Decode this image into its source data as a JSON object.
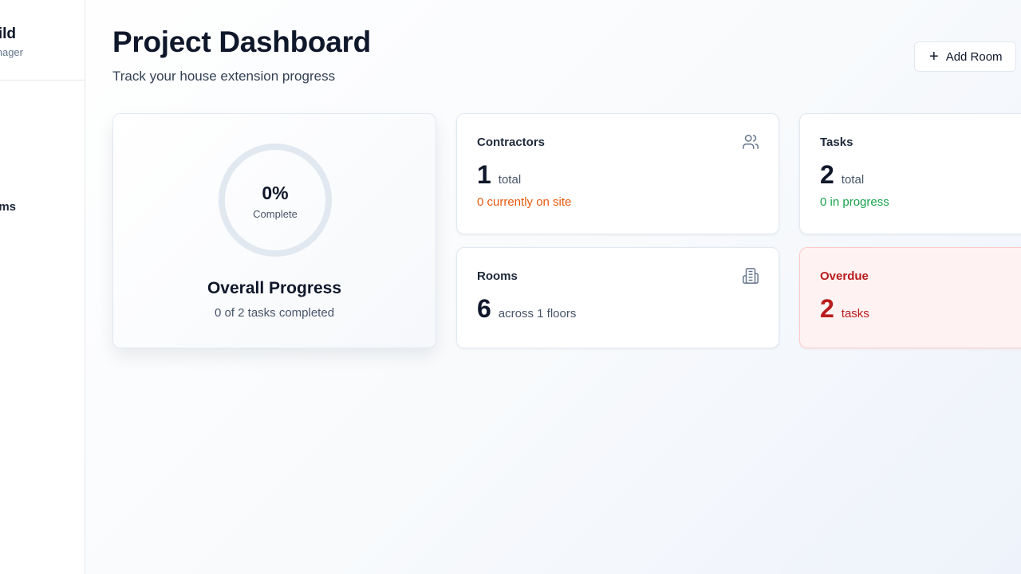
{
  "sidebar": {
    "brand_title": "uild",
    "brand_subtitle": "anager",
    "items": [
      {
        "label": "ms"
      }
    ]
  },
  "header": {
    "title": "Project Dashboard",
    "subtitle": "Track your house extension progress",
    "add_room_label": "Add Room"
  },
  "progress": {
    "percent_text": "0%",
    "fraction": 0,
    "ring_label": "Complete",
    "title": "Overall Progress",
    "subtitle": "0 of 2 tasks completed"
  },
  "stats": {
    "contractors": {
      "title": "Contractors",
      "value": "1",
      "unit": "total",
      "note": "0 currently on site",
      "icon": "users-icon"
    },
    "tasks": {
      "title": "Tasks",
      "value": "2",
      "unit": "total",
      "note": "0 in progress"
    },
    "rooms": {
      "title": "Rooms",
      "value": "6",
      "unit": "across 1 floors",
      "icon": "building-icon"
    },
    "overdue": {
      "title": "Overdue",
      "value": "2",
      "unit": "tasks"
    }
  },
  "colors": {
    "ring_track": "#e2e8f0",
    "accent_orange": "#ea580c",
    "accent_green": "#16a34a",
    "danger": "#b91c1c",
    "danger_bg": "#fef2f2"
  }
}
